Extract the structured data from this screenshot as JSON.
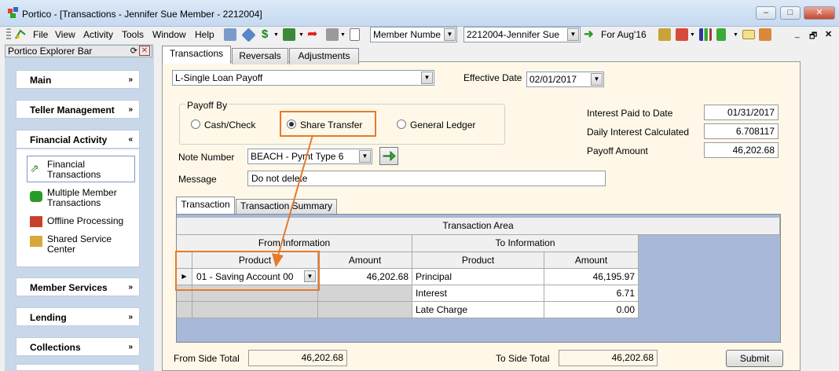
{
  "window": {
    "title": "Portico - [Transactions - Jennifer Sue Member - 2212004]",
    "min": "–",
    "max": "□",
    "close": "✕"
  },
  "menu": [
    "File",
    "View",
    "Activity",
    "Tools",
    "Window",
    "Help"
  ],
  "toolbar": {
    "search_by": "Member Numbe",
    "member": "2212004-Jennifer Sue",
    "period": "For Aug'16"
  },
  "explorer": {
    "title": "Portico Explorer Bar",
    "sections": {
      "main": "Main",
      "teller": "Teller Management",
      "financial": "Financial Activity",
      "member_services": "Member Services",
      "lending": "Lending",
      "collections": "Collections"
    },
    "items": {
      "financial_transactions": "Financial\nTransactions",
      "multiple_member": "Multiple Member\nTransactions",
      "offline": "Offline Processing",
      "shared_service": "Shared Service\nCenter"
    }
  },
  "tabs": {
    "transactions": "Transactions",
    "reversals": "Reversals",
    "adjustments": "Adjustments"
  },
  "form": {
    "transaction_type": "L-Single Loan Payoff",
    "effective_date_label": "Effective Date",
    "effective_date": "02/01/2017",
    "payoff_by_label": "Payoff By",
    "payoff_options": {
      "cash": "Cash/Check",
      "share": "Share Transfer",
      "gl": "General Ledger"
    },
    "note_number_label": "Note Number",
    "note_number": "BEACH - Pymt Type 6",
    "message_label": "Message",
    "message": "Do not delete",
    "interest_paid_label": "Interest Paid to Date",
    "interest_paid": "01/31/2017",
    "daily_interest_label": "Daily Interest Calculated",
    "daily_interest": "6.708117",
    "payoff_amount_label": "Payoff Amount",
    "payoff_amount": "46,202.68"
  },
  "subtabs": {
    "transaction": "Transaction",
    "summary": "Transaction Summary"
  },
  "grid": {
    "area_title": "Transaction Area",
    "from_info": "From Information",
    "to_info": "To Information",
    "headers": {
      "product": "Product",
      "amount": "Amount",
      "to_product": "Product",
      "to_amount": "Amount"
    },
    "from_product": "01 - Saving Account 00",
    "from_amount": "46,202.68",
    "rows": [
      {
        "product": "Principal",
        "amount": "46,195.97"
      },
      {
        "product": "Interest",
        "amount": "6.71"
      },
      {
        "product": "Late Charge",
        "amount": "0.00"
      }
    ]
  },
  "totals": {
    "from_label": "From Side Total",
    "from_value": "46,202.68",
    "to_label": "To Side Total",
    "to_value": "46,202.68"
  },
  "submit": "Submit",
  "colors": {
    "annotation": "#e57b2b",
    "selection_blue": "#3b6fb6"
  }
}
